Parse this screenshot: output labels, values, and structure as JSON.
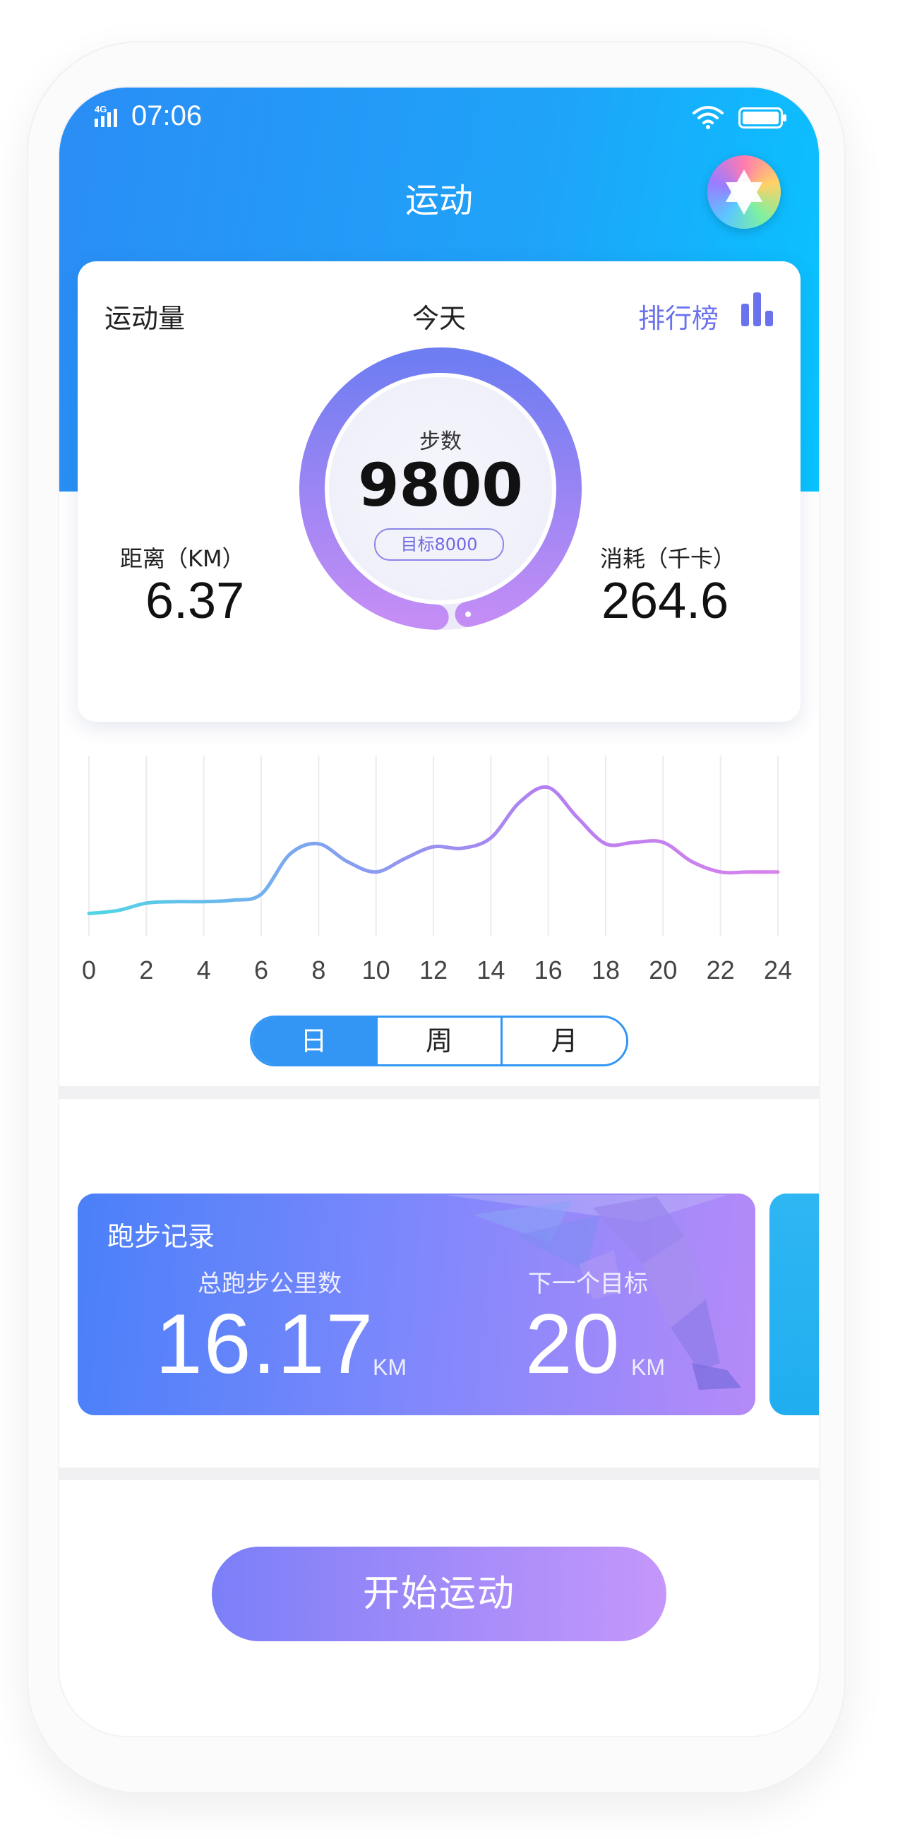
{
  "status_bar": {
    "network": "4G",
    "time": "07:06"
  },
  "header": {
    "title": "运动"
  },
  "stats_card": {
    "activity_label": "运动量",
    "period_label": "今天",
    "ranking_label": "排行榜",
    "steps_label": "步数",
    "steps_value": "9800",
    "goal_label": "目标8000",
    "steps_progress": 0.96,
    "distance_label": "距离（KM）",
    "distance_value": "6.37",
    "calories_label": "消耗（千卡）",
    "calories_value": "264.6"
  },
  "chart_data": {
    "type": "line",
    "x": [
      0,
      1,
      2,
      3,
      4,
      5,
      6,
      7,
      8,
      9,
      10,
      11,
      12,
      13,
      14,
      15,
      16,
      17,
      18,
      19,
      20,
      21,
      22,
      23,
      24
    ],
    "y": [
      5,
      7,
      12,
      13,
      13,
      14,
      18,
      45,
      52,
      40,
      33,
      42,
      50,
      49,
      56,
      80,
      90,
      70,
      52,
      53,
      53,
      40,
      33,
      33,
      33
    ],
    "x_ticks": [
      "0",
      "2",
      "4",
      "6",
      "8",
      "10",
      "12",
      "14",
      "16",
      "18",
      "20",
      "22",
      "24"
    ],
    "xlim": [
      0,
      24
    ],
    "ylim": [
      0,
      100
    ],
    "grid": "vertical",
    "gradient_colors": [
      "#4fd6e6",
      "#7fa3f0",
      "#b47ff0",
      "#d982ec"
    ]
  },
  "period_tabs": [
    "日",
    "周",
    "月"
  ],
  "period_tabs_selected": "日",
  "run_card": {
    "title": "跑步记录",
    "total_label": "总跑步公里数",
    "total_value": "16.17",
    "total_unit": "KM",
    "next_label": "下一个目标",
    "next_value": "20",
    "next_unit": "KM"
  },
  "start_button": {
    "label": "开始运动"
  },
  "icons": [
    "signal-icon",
    "wifi-icon",
    "battery-icon",
    "app-logo-icon",
    "ranking-chart-icon",
    "runner-illustration"
  ]
}
